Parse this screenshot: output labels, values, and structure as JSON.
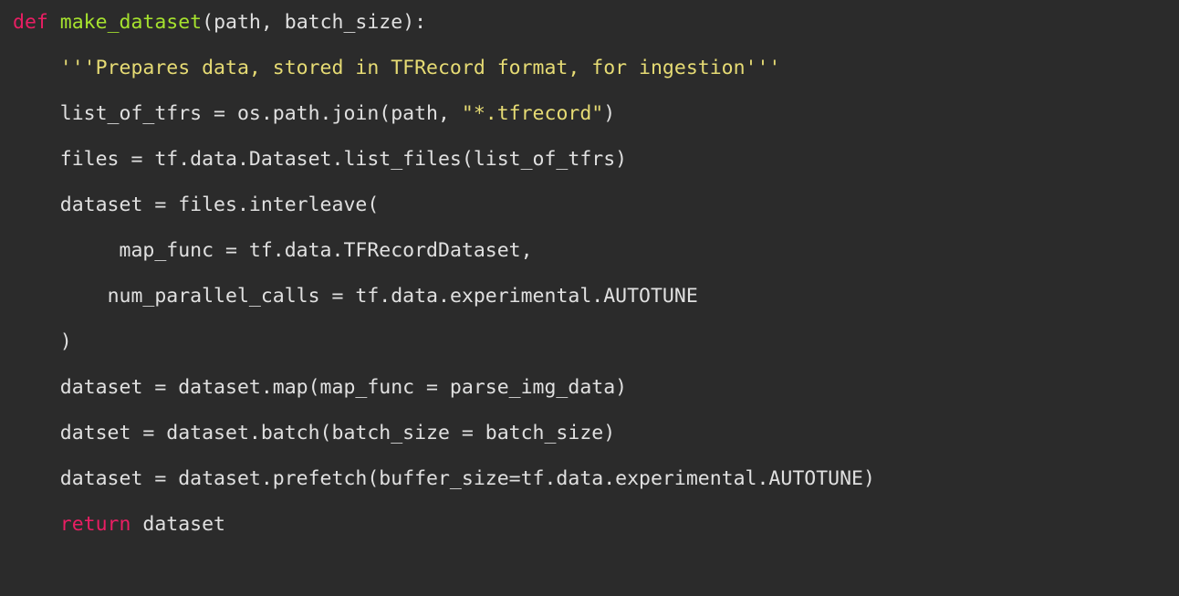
{
  "code": {
    "lines": [
      {
        "indent": 0,
        "tokens": [
          {
            "cls": "kw",
            "key": "def_kw"
          },
          {
            "cls": "txt",
            "key": "space1"
          },
          {
            "cls": "fn",
            "key": "fn_name"
          },
          {
            "cls": "txt",
            "key": "sig"
          }
        ]
      },
      {
        "indent": 1,
        "tokens": [
          {
            "cls": "str",
            "key": "docstring"
          }
        ]
      },
      {
        "indent": 1,
        "tokens": [
          {
            "cls": "txt",
            "key": "l3a"
          },
          {
            "cls": "str",
            "key": "l3b"
          },
          {
            "cls": "txt",
            "key": "l3c"
          }
        ]
      },
      {
        "indent": 1,
        "tokens": [
          {
            "cls": "txt",
            "key": "l4"
          }
        ]
      },
      {
        "indent": 1,
        "tokens": [
          {
            "cls": "txt",
            "key": "l5"
          }
        ]
      },
      {
        "indent": 2,
        "tokens": [
          {
            "cls": "txt",
            "key": "l6"
          }
        ]
      },
      {
        "indent": 2,
        "tokens": [
          {
            "cls": "txt",
            "key": "l7"
          }
        ]
      },
      {
        "indent": 1,
        "tokens": [
          {
            "cls": "txt",
            "key": "l8"
          }
        ]
      },
      {
        "indent": 1,
        "tokens": [
          {
            "cls": "txt",
            "key": "l9"
          }
        ]
      },
      {
        "indent": 1,
        "tokens": [
          {
            "cls": "txt",
            "key": "l10"
          }
        ]
      },
      {
        "indent": 1,
        "tokens": [
          {
            "cls": "txt",
            "key": "l11"
          }
        ]
      },
      {
        "indent": 1,
        "tokens": [
          {
            "cls": "kw",
            "key": "return_kw"
          },
          {
            "cls": "txt",
            "key": "l12b"
          }
        ]
      }
    ],
    "strings": {
      "def_kw": "def",
      "space1": " ",
      "fn_name": "make_dataset",
      "sig": "(path, batch_size):",
      "docstring": "'''Prepares data, stored in TFRecord format, for ingestion'''",
      "l3a": "list_of_tfrs = os.path.join(path, ",
      "l3b": "\"*.tfrecord\"",
      "l3c": ")",
      "l4": "files = tf.data.Dataset.list_files(list_of_tfrs)",
      "l5": "dataset = files.interleave(",
      "l6": " map_func = tf.data.TFRecordDataset,",
      "l7": "num_parallel_calls = tf.data.experimental.AUTOTUNE",
      "l8": ")",
      "l9": "dataset = dataset.map(map_func = parse_img_data)",
      "l10": "datset = dataset.batch(batch_size = batch_size)",
      "l11": "dataset = dataset.prefetch(buffer_size=tf.data.experimental.AUTOTUNE)",
      "return_kw": "return",
      "l12b": " dataset"
    },
    "indent_unit": "    "
  }
}
